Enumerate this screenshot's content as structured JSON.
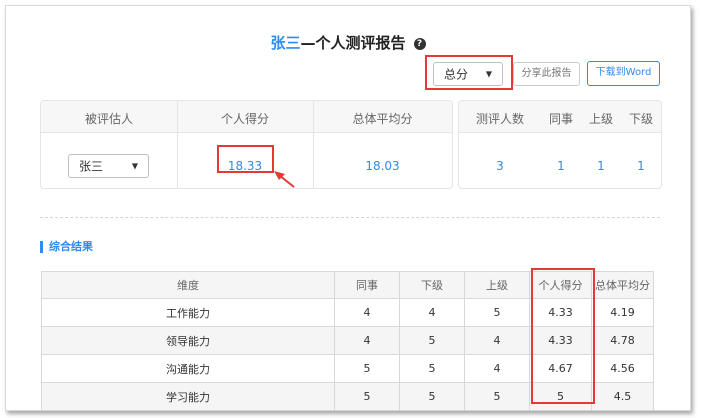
{
  "title": {
    "name": "张三",
    "rest": "—个人测评报告",
    "help_icon": "question-circle-icon"
  },
  "toolbar": {
    "score_select": "总分",
    "share_label": "分享此报告",
    "download_label": "下载到Word"
  },
  "summary": {
    "headers": {
      "evaluatee": "被评估人",
      "personal_score": "个人得分",
      "avg_score": "总体平均分"
    },
    "evaluatee_select": "张三",
    "personal_score": "18.33",
    "avg_score": "18.03"
  },
  "counts": {
    "headers": {
      "total": "测评人数",
      "peer": "同事",
      "superior": "上级",
      "subordinate": "下级"
    },
    "total": "3",
    "peer": "1",
    "superior": "1",
    "subordinate": "1"
  },
  "section": {
    "title": "综合结果"
  },
  "results": {
    "headers": [
      "维度",
      "同事",
      "下级",
      "上级",
      "个人得分",
      "总体平均分"
    ],
    "rows": [
      [
        "工作能力",
        "4",
        "4",
        "5",
        "4.33",
        "4.19"
      ],
      [
        "领导能力",
        "4",
        "5",
        "4",
        "4.33",
        "4.78"
      ],
      [
        "沟通能力",
        "5",
        "5",
        "4",
        "4.67",
        "4.56"
      ],
      [
        "学习能力",
        "5",
        "5",
        "5",
        "5",
        "4.5"
      ]
    ]
  },
  "colors": {
    "accent": "#2d8cf0",
    "highlight": "#e53935"
  }
}
